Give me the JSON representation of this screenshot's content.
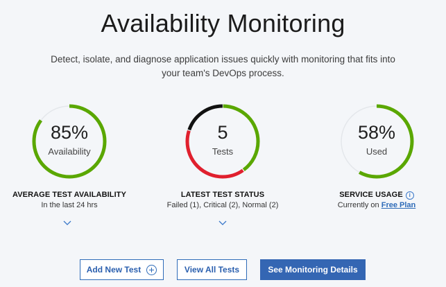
{
  "header": {
    "title": "Availability Monitoring",
    "subtitle": "Detect, isolate, and diagnose application issues quickly with monitoring that fits into your team's DevOps process."
  },
  "metrics": [
    {
      "value": "85%",
      "caption": "Availability",
      "label": "AVERAGE TEST AVAILABILITY",
      "sublabel": "In the last 24 hrs",
      "progress": 0.85,
      "color": "#5aa700"
    },
    {
      "value": "5",
      "caption": "Tests",
      "label": "LATEST TEST STATUS",
      "sublabel": "Failed (1), Critical (2), Normal (2)",
      "segments": [
        {
          "status": "Failed",
          "count": 1,
          "color": "#111111"
        },
        {
          "status": "Critical",
          "count": 2,
          "color": "#e0202e"
        },
        {
          "status": "Normal",
          "count": 2,
          "color": "#5aa700"
        }
      ]
    },
    {
      "value": "58%",
      "caption": "Used",
      "label": "SERVICE USAGE",
      "sublabel_prefix": "Currently on",
      "sublabel_link": "Free Plan",
      "progress": 0.58,
      "color": "#5aa700"
    }
  ],
  "buttons": {
    "add_new_test": "Add New Test",
    "view_all_tests": "View All Tests",
    "see_monitoring_details": "See Monitoring Details"
  },
  "colors": {
    "accent": "#3466b3",
    "track": "#e4e7eb",
    "success": "#5aa700"
  }
}
